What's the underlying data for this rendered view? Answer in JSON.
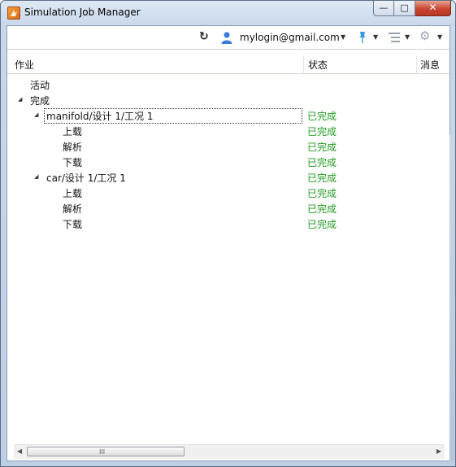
{
  "window": {
    "title": "Simulation Job Manager",
    "controls": {
      "minimize": "—",
      "maximize": "□",
      "close": "✕"
    }
  },
  "toolbar": {
    "refresh_icon": "↻",
    "user_email": "mylogin@gmail.com",
    "caret": "▼",
    "gear_icon": "⚙"
  },
  "columns": {
    "job": "作业",
    "status": "状态",
    "message": "消息"
  },
  "tree": {
    "active": {
      "label": "活动"
    },
    "completed": {
      "label": "完成",
      "toggle": "◢",
      "jobs": [
        {
          "label": "manifold/设计 1/工况 1",
          "status": "已完成",
          "toggle": "◢",
          "steps": [
            {
              "label": "上载",
              "status": "已完成"
            },
            {
              "label": "解析",
              "status": "已完成"
            },
            {
              "label": "下载",
              "status": "已完成"
            }
          ]
        },
        {
          "label": "car/设计 1/工况 1",
          "status": "已完成",
          "toggle": "◢",
          "steps": [
            {
              "label": "上载",
              "status": "已完成"
            },
            {
              "label": "解析",
              "status": "已完成"
            },
            {
              "label": "下载",
              "status": "已完成"
            }
          ]
        }
      ]
    }
  },
  "scrollbar": {
    "left_arrow": "◀",
    "right_arrow": "▶",
    "grip": "III"
  },
  "colors": {
    "status_complete": "#1f9a1f",
    "close_button": "#c8452f"
  }
}
